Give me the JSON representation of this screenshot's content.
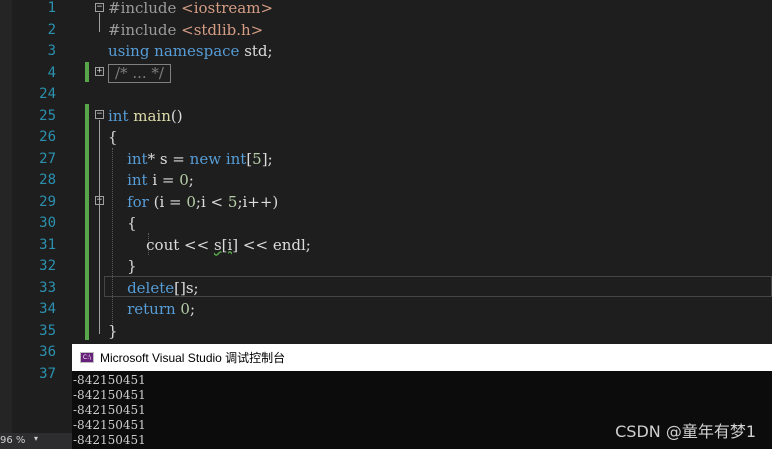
{
  "editor": {
    "lines": [
      {
        "num": "1",
        "tokens": [
          {
            "t": "#include ",
            "c": "pp"
          },
          {
            "t": "<iostream>",
            "c": "str"
          }
        ]
      },
      {
        "num": "2",
        "tokens": [
          {
            "t": "#include ",
            "c": "pp"
          },
          {
            "t": "<stdlib.h>",
            "c": "str"
          }
        ]
      },
      {
        "num": "3",
        "tokens": [
          {
            "t": "using namespace ",
            "c": "kw"
          },
          {
            "t": "std;",
            "c": "id"
          }
        ]
      },
      {
        "num": "4",
        "tokens": [
          {
            "t": "/* ... */",
            "c": "collapsed"
          }
        ]
      },
      {
        "num": "24",
        "tokens": []
      },
      {
        "num": "25",
        "tokens": [
          {
            "t": "int ",
            "c": "kw"
          },
          {
            "t": "main",
            "c": "fn"
          },
          {
            "t": "()",
            "c": "id"
          }
        ]
      },
      {
        "num": "26",
        "tokens": [
          {
            "t": "{",
            "c": "id"
          }
        ]
      },
      {
        "num": "27",
        "tokens": [
          {
            "t": "    "
          },
          {
            "t": "int",
            "c": "kw"
          },
          {
            "t": "* s = ",
            "c": "id"
          },
          {
            "t": "new ",
            "c": "kw"
          },
          {
            "t": "int",
            "c": "kw"
          },
          {
            "t": "[",
            "c": "id"
          },
          {
            "t": "5",
            "c": "num"
          },
          {
            "t": "];",
            "c": "id"
          }
        ]
      },
      {
        "num": "28",
        "tokens": [
          {
            "t": "    "
          },
          {
            "t": "int ",
            "c": "kw"
          },
          {
            "t": "i = ",
            "c": "id"
          },
          {
            "t": "0",
            "c": "num"
          },
          {
            "t": ";",
            "c": "id"
          }
        ]
      },
      {
        "num": "29",
        "tokens": [
          {
            "t": "    "
          },
          {
            "t": "for ",
            "c": "kw"
          },
          {
            "t": "(i = ",
            "c": "id"
          },
          {
            "t": "0",
            "c": "num"
          },
          {
            "t": ";i < ",
            "c": "id"
          },
          {
            "t": "5",
            "c": "num"
          },
          {
            "t": ";i++)",
            "c": "id"
          }
        ]
      },
      {
        "num": "30",
        "tokens": [
          {
            "t": "    {",
            "c": "id"
          }
        ]
      },
      {
        "num": "31",
        "tokens": [
          {
            "t": "        cout << ",
            "c": "id"
          },
          {
            "t": "s[i]",
            "c": "squig"
          },
          {
            "t": " << endl;",
            "c": "id"
          }
        ]
      },
      {
        "num": "32",
        "tokens": [
          {
            "t": "    }",
            "c": "id"
          }
        ]
      },
      {
        "num": "33",
        "tokens": [
          {
            "t": "    "
          },
          {
            "t": "delete",
            "c": "kw"
          },
          {
            "t": "[]s;",
            "c": "id"
          }
        ]
      },
      {
        "num": "34",
        "tokens": [
          {
            "t": "    "
          },
          {
            "t": "return ",
            "c": "kw"
          },
          {
            "t": "0",
            "c": "num"
          },
          {
            "t": ";",
            "c": "id"
          }
        ]
      },
      {
        "num": "35",
        "tokens": [
          {
            "t": "}",
            "c": "id"
          }
        ]
      },
      {
        "num": "36",
        "tokens": []
      },
      {
        "num": "37",
        "tokens": []
      }
    ]
  },
  "console": {
    "icon_label": "C:\\",
    "title": "Microsoft Visual Studio 调试控制台",
    "output": [
      "-842150451",
      "-842150451",
      "-842150451",
      "-842150451",
      "-842150451"
    ]
  },
  "statusbar": {
    "zoom": "96 %",
    "zoom_dropdown": "▾"
  },
  "watermark": "CSDN @童年有梦1"
}
